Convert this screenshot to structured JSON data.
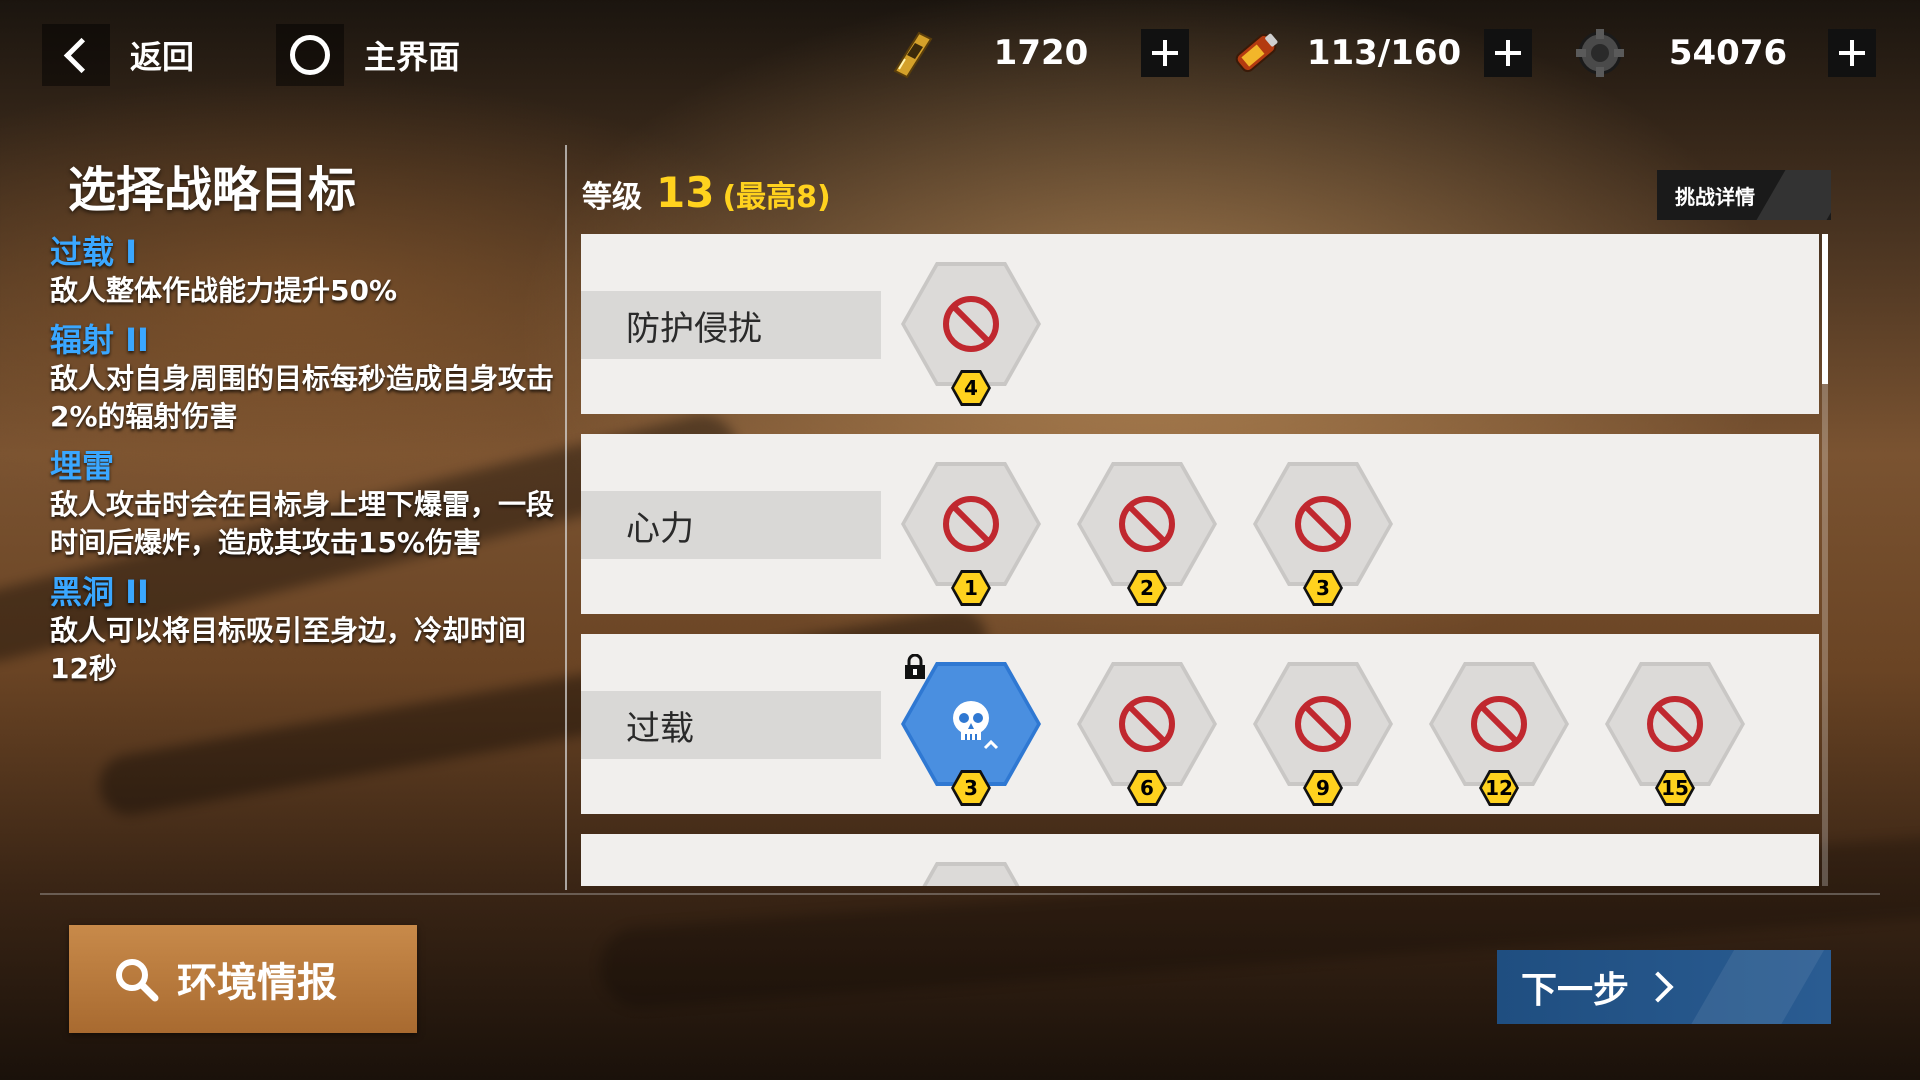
{
  "nav": {
    "back_label": "返回",
    "home_label": "主界面"
  },
  "resources": [
    {
      "icon": "fuel-icon",
      "value": "1720"
    },
    {
      "icon": "battery-icon",
      "value": "113/160"
    },
    {
      "icon": "gear-parts-icon",
      "value": "54076"
    }
  ],
  "left": {
    "title": "选择战略目标",
    "effects": [
      {
        "name": "过载 I",
        "desc": "敌人整体作战能力提升50%"
      },
      {
        "name": "辐射 II",
        "desc": "敌人对自身周围的目标每秒造成自身攻击2%的辐射伤害"
      },
      {
        "name": "埋雷",
        "desc": "敌人攻击时会在目标身上埋下爆雷，一段时间后爆炸，造成其攻击15%伤害"
      },
      {
        "name": "黑洞 II",
        "desc": "敌人可以将目标吸引至身边，冷却时间12秒"
      }
    ]
  },
  "level": {
    "label": "等级",
    "value": "13",
    "max": "(最高8)"
  },
  "challenge_detail_label": "挑战详情",
  "rows": [
    {
      "label": "防护侵扰",
      "nodes": [
        {
          "badge": "4",
          "state": "banned"
        }
      ]
    },
    {
      "label": "心力",
      "nodes": [
        {
          "badge": "1",
          "state": "banned"
        },
        {
          "badge": "2",
          "state": "banned"
        },
        {
          "badge": "3",
          "state": "banned"
        }
      ]
    },
    {
      "label": "过载",
      "nodes": [
        {
          "badge": "3",
          "state": "selected",
          "locked": true
        },
        {
          "badge": "6",
          "state": "banned"
        },
        {
          "badge": "9",
          "state": "banned"
        },
        {
          "badge": "12",
          "state": "banned"
        },
        {
          "badge": "15",
          "state": "banned"
        }
      ]
    }
  ],
  "colors": {
    "accent_blue": "#3aa7ff",
    "level_yellow": "#ffd21e",
    "selected_hex": "#2f78d2",
    "ban_red": "#c0282f"
  },
  "bottom": {
    "env_label": "环境情报",
    "next_label": "下一步"
  }
}
